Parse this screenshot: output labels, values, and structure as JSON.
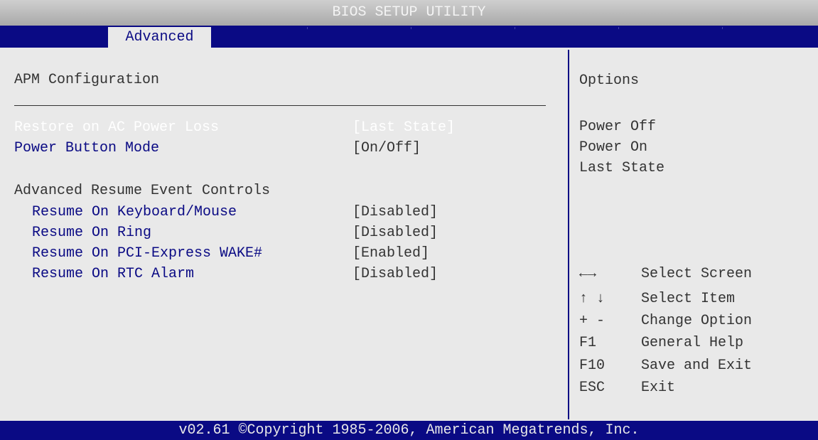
{
  "title": "BIOS SETUP UTILITY",
  "tabs": [
    {
      "label": "Advanced",
      "active": true
    }
  ],
  "section_title": "APM Configuration",
  "settings": [
    {
      "label": "Restore on AC Power Loss",
      "value": "[Last State]",
      "disabled": true
    },
    {
      "label": "Power Button Mode",
      "value": "[On/Off]",
      "disabled": false
    }
  ],
  "subsection_title": "Advanced Resume Event Controls",
  "resume_settings": [
    {
      "label": "Resume On Keyboard/Mouse",
      "value": "[Disabled]"
    },
    {
      "label": "Resume On Ring",
      "value": "[Disabled]"
    },
    {
      "label": "Resume On PCI-Express WAKE#",
      "value": "[Enabled]"
    },
    {
      "label": "Resume On RTC Alarm",
      "value": "[Disabled]"
    }
  ],
  "help_panel": {
    "title": "Options",
    "options": [
      "Power Off",
      "Power On",
      "Last State"
    ]
  },
  "key_legend": [
    {
      "key": "←→",
      "desc": "Select Screen"
    },
    {
      "key": "↑ ↓",
      "desc": "Select Item"
    },
    {
      "key": "+ -",
      "desc": "Change Option"
    },
    {
      "key": "F1",
      "desc": "General Help"
    },
    {
      "key": "F10",
      "desc": "Save and Exit"
    },
    {
      "key": "ESC",
      "desc": "Exit"
    }
  ],
  "footer": "v02.61 ©Copyright 1985-2006, American Megatrends, Inc.",
  "colors": {
    "menu_bar": "#0a0a84",
    "panel": "#e9e9e9",
    "title_bar": "#bdbdbd",
    "highlight_text": "#0a0a84",
    "disabled_text": "#ffffff"
  }
}
